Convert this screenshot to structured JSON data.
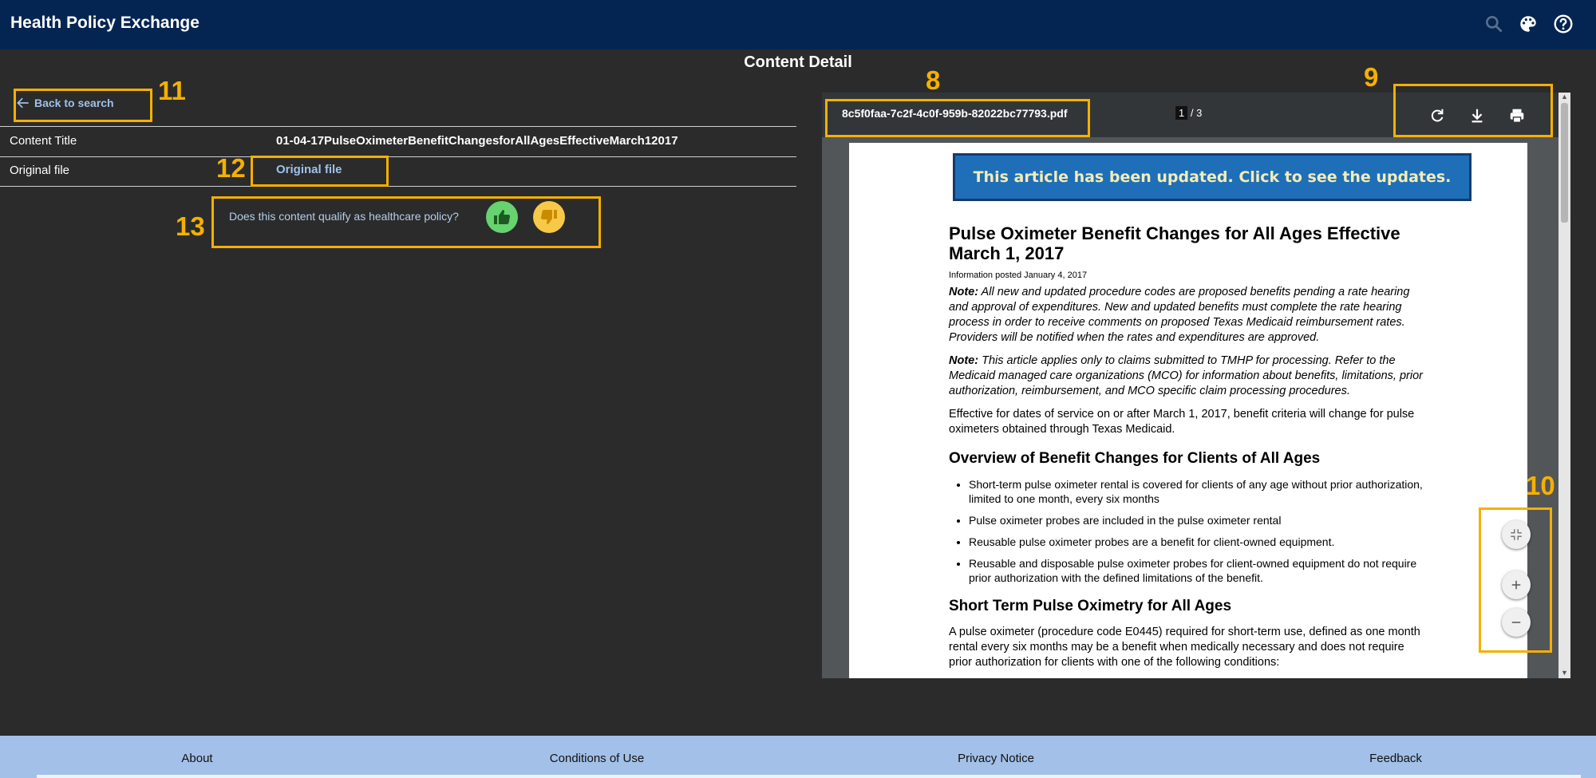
{
  "header": {
    "app_title": "Health Policy Exchange",
    "icons": [
      "search-icon",
      "palette-icon",
      "help-icon"
    ]
  },
  "page": {
    "title": "Content Detail"
  },
  "back": {
    "label": "Back to search"
  },
  "details": {
    "content_title_label": "Content Title",
    "content_title_value": "01-04-17PulseOximeterBenefitChangesforAllAgesEffectiveMarch12017",
    "original_file_label": "Original file",
    "original_file_link": "Original file"
  },
  "feedback": {
    "question": "Does this content qualify as healthcare policy?",
    "up_color": "#66d36e",
    "down_color": "#f7c948"
  },
  "viewer": {
    "file_name": "8c5f0faa-7c2f-4c0f-959b-82022bc77793.pdf",
    "page_current": "1",
    "page_total": "/ 3",
    "tools": [
      "rotate-icon",
      "download-icon",
      "print-icon"
    ],
    "zoom_tools": [
      "fit-page-icon",
      "zoom-in-icon",
      "zoom-out-icon"
    ]
  },
  "pdf": {
    "banner": "This article has been updated. Click to see the updates.",
    "title": "Pulse Oximeter Benefit Changes for All Ages Effective March 1, 2017",
    "posted": "Information posted January 4, 2017",
    "note1_label": "Note:",
    "note1_text": " All new and updated procedure codes are proposed benefits pending a rate hearing and approval of expenditures. New and updated benefits must complete the rate hearing process in order to receive comments on proposed Texas Medicaid reimbursement rates. Providers will be notified when the rates and expenditures are approved.",
    "note2_label": "Note:",
    "note2_text": " This article applies only to claims submitted to TMHP for processing. Refer to the Medicaid managed care organizations (MCO) for information about benefits, limitations, prior authorization, reimbursement, and MCO specific claim processing procedures.",
    "effective": "Effective for dates of service on or after March 1, 2017, benefit criteria will change for pulse oximeters obtained through Texas Medicaid.",
    "overview_heading": "Overview of Benefit Changes for Clients of All Ages",
    "overview_items": [
      "Short-term pulse oximeter rental is covered for clients of any age without prior authorization, limited to one month, every six months",
      "Pulse oximeter probes are included in the pulse oximeter rental",
      "Reusable pulse oximeter probes are a benefit for client-owned equipment.",
      "Reusable and disposable pulse oximeter probes for client-owned equipment do not require prior authorization with the defined limitations of the benefit."
    ],
    "short_term_heading": "Short Term Pulse Oximetry for All Ages",
    "short_term_text": "A pulse oximeter (procedure code E0445) required for short-term use, defined as one month rental every six months may be a benefit when medically necessary and does not require prior authorization for clients with one of the following conditions:"
  },
  "annotations": {
    "file_name": "8",
    "toolbar": "9",
    "zoom": "10",
    "back": "11",
    "original": "12",
    "feedback": "13",
    "color": "#f5b000"
  },
  "footer": {
    "about": "About",
    "conditions": "Conditions of Use",
    "privacy": "Privacy Notice",
    "feedback": "Feedback"
  }
}
